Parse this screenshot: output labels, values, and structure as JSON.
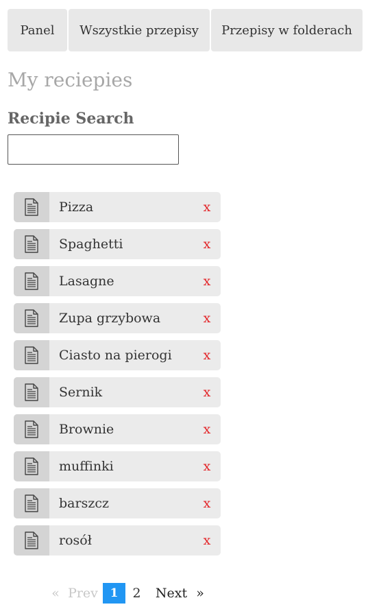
{
  "nav": {
    "tabs": [
      {
        "label": "Panel"
      },
      {
        "label": "Wszystkie przepisy"
      },
      {
        "label": "Przepisy w folderach"
      }
    ]
  },
  "page_title": "My reciepies",
  "search": {
    "title": "Recipie Search",
    "value": "",
    "placeholder": ""
  },
  "recipes": [
    {
      "name": "Pizza",
      "delete_label": "x",
      "icon": "document-icon"
    },
    {
      "name": "Spaghetti",
      "delete_label": "x",
      "icon": "document-icon"
    },
    {
      "name": "Lasagne",
      "delete_label": "x",
      "icon": "document-icon"
    },
    {
      "name": "Zupa grzybowa",
      "delete_label": "x",
      "icon": "document-icon"
    },
    {
      "name": "Ciasto na pierogi",
      "delete_label": "x",
      "icon": "document-icon"
    },
    {
      "name": "Sernik",
      "delete_label": "x",
      "icon": "document-icon"
    },
    {
      "name": "Brownie",
      "delete_label": "x",
      "icon": "document-icon"
    },
    {
      "name": "muffinki",
      "delete_label": "x",
      "icon": "document-icon"
    },
    {
      "name": "barszcz",
      "delete_label": "x",
      "icon": "document-icon"
    },
    {
      "name": "rosół",
      "delete_label": "x",
      "icon": "document-icon"
    }
  ],
  "pagination": {
    "prev_arrow": "«",
    "prev_label": "Prev",
    "pages": [
      "1",
      "2"
    ],
    "current_page": "1",
    "next_label": "Next",
    "next_arrow": "»"
  },
  "colors": {
    "accent": "#2196f3",
    "delete": "#e3262a",
    "tab_bg": "#e8e8e8",
    "item_bg": "#ebebeb",
    "icon_bg": "#d4d4d4"
  }
}
